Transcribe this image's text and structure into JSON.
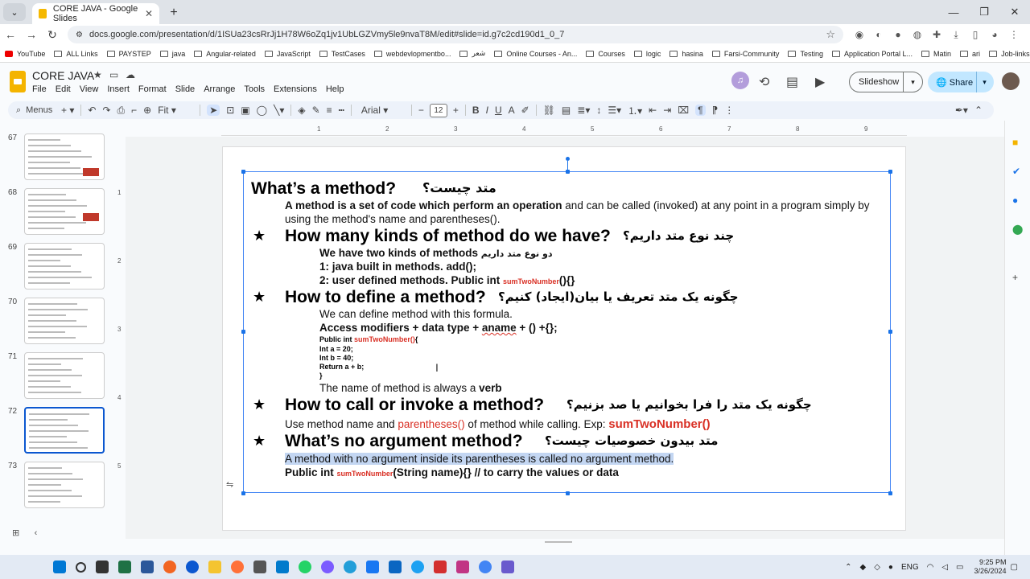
{
  "browser": {
    "tab_title": "CORE JAVA - Google Slides",
    "url": "docs.google.com/presentation/d/1ISUa23csRrJj1H78W6oZq1jv1UbLGZVmy5le9nvaT8M/edit#slide=id.g7c2cd190d1_0_7",
    "bookmarks": [
      "YouTube",
      "ALL Links",
      "PAYSTEP",
      "java",
      "Angular-related",
      "JavaScript",
      "TestCases",
      "webdevlopmentbo...",
      "شعر",
      "Online Courses - An...",
      "Courses",
      "logic",
      "hasina",
      "Farsi-Community",
      "Testing",
      "Application Portal L...",
      "Matin",
      "ari",
      "Job-links"
    ]
  },
  "docs": {
    "title": "CORE JAVA",
    "menus": [
      "File",
      "Edit",
      "View",
      "Insert",
      "Format",
      "Slide",
      "Arrange",
      "Tools",
      "Extensions",
      "Help"
    ],
    "slideshow_label": "Slideshow",
    "share_label": "Share"
  },
  "toolbar": {
    "search_label": "Menus",
    "zoom": "Fit",
    "font": "Arial",
    "font_size": "12"
  },
  "ruler": [
    "1",
    "2",
    "3",
    "4",
    "5",
    "6",
    "7",
    "8",
    "9"
  ],
  "vruler": [
    "1",
    "2",
    "3",
    "4",
    "5"
  ],
  "filmstrip": [
    {
      "num": "67"
    },
    {
      "num": "68"
    },
    {
      "num": "69"
    },
    {
      "num": "70"
    },
    {
      "num": "71"
    },
    {
      "num": "72",
      "active": true
    },
    {
      "num": "73"
    }
  ],
  "slide": {
    "h1_en": "What’s a method?",
    "h1_fa": "متد چیست؟",
    "p1_bold": "A method is a set of code which perform an operation",
    "p1_rest": " and can be called (invoked) at any point in a  program simply by",
    "p1_line2": "using the method's name and parentheses().",
    "h2_en": "How many kinds of method do we have?",
    "h2_fa": "چند نوع متد داریم؟",
    "kinds_line": "We have two kinds of methods",
    "kinds_fa": "دو نوع متد داریم",
    "kind1": "1: java built in methods.     add();",
    "kind2_a": "2: user defined methods.   Public int ",
    "kind2_red": "sumTwoNumber",
    "kind2_b": "(){}",
    "h3_en": "How to define a method?",
    "h3_fa": "چگونه یک متد تعریف یا بیان(ایجاد)  کنیم؟",
    "define_intro": "We can define method with this formula.",
    "formula_a": "Access modifiers + data type + ",
    "formula_aname": "aname",
    "formula_b": " + () +{};",
    "code_l1_a": "Public int ",
    "code_l1_red": "sumTwoNumber()",
    "code_l1_b": "{",
    "code_l2": "Int a = 20;",
    "code_l3": "Int b = 40;",
    "code_l4": "Return a + b;",
    "code_l5": "}",
    "verb_a": "The name of method is always a ",
    "verb_b": "verb",
    "h4_en": "How to call or invoke  a method?",
    "h4_fa": "چگونه یک متد را فرا بخوانیم یا صد بزنیم؟",
    "call_a": "Use method name and ",
    "call_red": "parentheses()",
    "call_b": " of method while calling. Exp: ",
    "call_red2": "sumTwoNumber()",
    "h5_en": "What’s  no argument method?",
    "h5_fa": "متد بیدون خصوصیات چیست؟",
    "noarg_line": "A method with no argument inside its parentheses is called no argument method.",
    "last_a": "Public int ",
    "last_red": "sumTwoNumber",
    "last_b": "(String name){}     // to carry the values or data"
  },
  "system": {
    "lang": "ENG",
    "time": "9:25 PM",
    "date": "3/26/2024"
  },
  "colors": {
    "accent": "#1a73e8",
    "red_code": "#d93025",
    "selection": "#c3d6f2"
  }
}
